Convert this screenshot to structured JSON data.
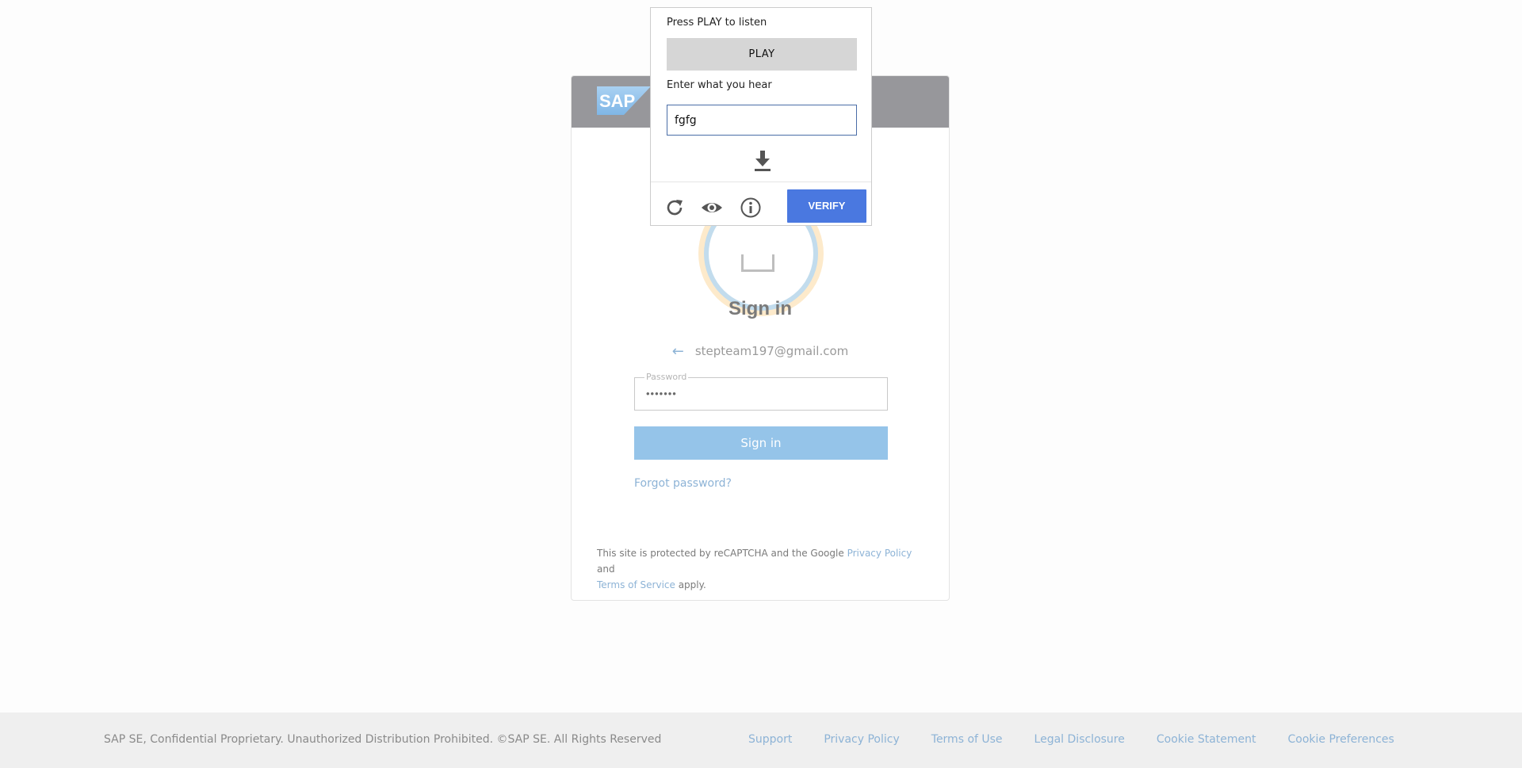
{
  "brand": {
    "logo_text": "SAP",
    "header_color": "#97979b"
  },
  "login": {
    "title": "Sign in",
    "email": "stepteam197@gmail.com",
    "password_label": "Password",
    "password_value": "•••••••",
    "signin_button": "Sign in",
    "forgot_link": "Forgot password?",
    "recaptcha_prefix": "This site is protected by reCAPTCHA and the Google ",
    "recaptcha_privacy": "Privacy Policy",
    "recaptcha_and": " and",
    "recaptcha_terms": "Terms of Service",
    "recaptcha_suffix": " apply."
  },
  "captcha": {
    "instruction": "Press PLAY to listen",
    "play_button": "PLAY",
    "enter_label": "Enter what you hear",
    "input_value": "fgfg",
    "verify_button": "VERIFY",
    "icons": [
      "download-icon",
      "reload-icon",
      "eye-icon",
      "info-icon"
    ]
  },
  "footer": {
    "copyright": "SAP SE, Confidential Proprietary. Unauthorized Distribution Prohibited. ©SAP SE. All Rights Reserved",
    "links": [
      "Support",
      "Privacy Policy",
      "Terms of Use",
      "Legal Disclosure",
      "Cookie Statement",
      "Cookie Preferences"
    ]
  },
  "colors": {
    "link": "#8db3d6",
    "signin_button": "#95c4e9",
    "verify_button": "#4a78e0"
  }
}
